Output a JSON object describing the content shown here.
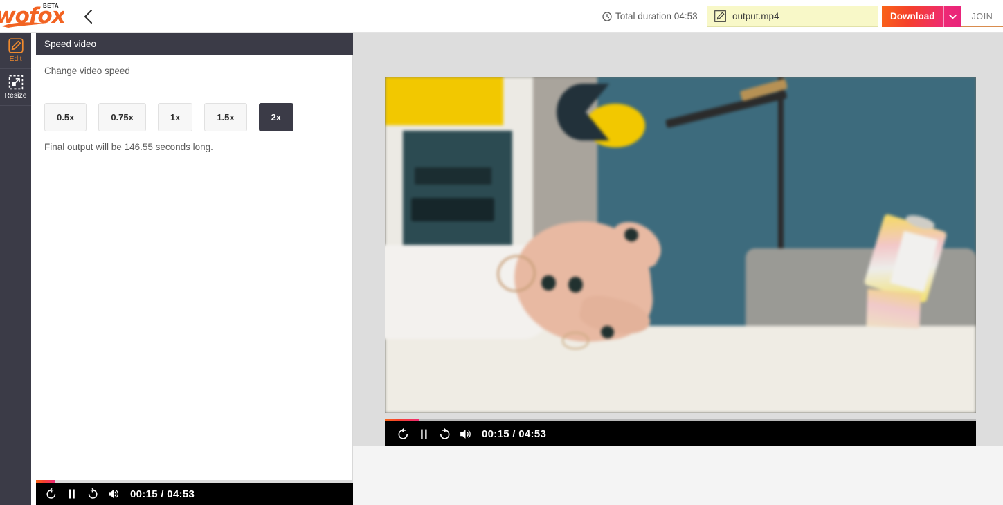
{
  "app": {
    "logo_text": "wofox",
    "logo_badge": "BETA"
  },
  "header": {
    "back_icon": "chevron-left-icon",
    "duration": {
      "icon": "clock-icon",
      "label": "Total duration 04:53"
    },
    "filename": {
      "icon": "pencil-edit-icon",
      "value": "output.mp4",
      "placeholder": "output.mp4"
    },
    "download_label": "Download",
    "download_caret_icon": "chevron-down-icon",
    "join_label": "JOIN"
  },
  "sidebar": {
    "items": [
      {
        "label": "Edit",
        "icon": "pencil-square-icon",
        "active": true
      },
      {
        "label": "Resize",
        "icon": "resize-arrow-icon",
        "active": false
      }
    ]
  },
  "panel": {
    "title": "Speed video",
    "field_label": "Change video speed",
    "speed_options": [
      {
        "label": "0.5x",
        "selected": false
      },
      {
        "label": "0.75x",
        "selected": false
      },
      {
        "label": "1x",
        "selected": false
      },
      {
        "label": "1.5x",
        "selected": false
      },
      {
        "label": "2x",
        "selected": true
      }
    ],
    "final_note": "Final output will be 146.55 seconds long."
  },
  "panel_player": {
    "rewind_icon": "rewind-10-icon",
    "pause_icon": "pause-icon",
    "forward_icon": "forward-10-icon",
    "volume_icon": "volume-on-icon",
    "time": "00:15 / 04:53",
    "current_time": "00:15",
    "total_time": "04:53",
    "progress_percent": 6
  },
  "main_player": {
    "rewind_icon": "rewind-10-icon",
    "pause_icon": "pause-icon",
    "forward_icon": "forward-10-icon",
    "volume_icon": "volume-on-icon",
    "time": "00:15 / 04:53",
    "current_time": "00:15",
    "total_time": "04:53",
    "progress_percent": 6
  },
  "colors": {
    "brand_orange": "#f26322",
    "accent_pink": "#ee2a74",
    "dark_chrome": "#3b3b47",
    "stage_bg": "#dddddd",
    "filename_bg": "#f8f8c8"
  }
}
